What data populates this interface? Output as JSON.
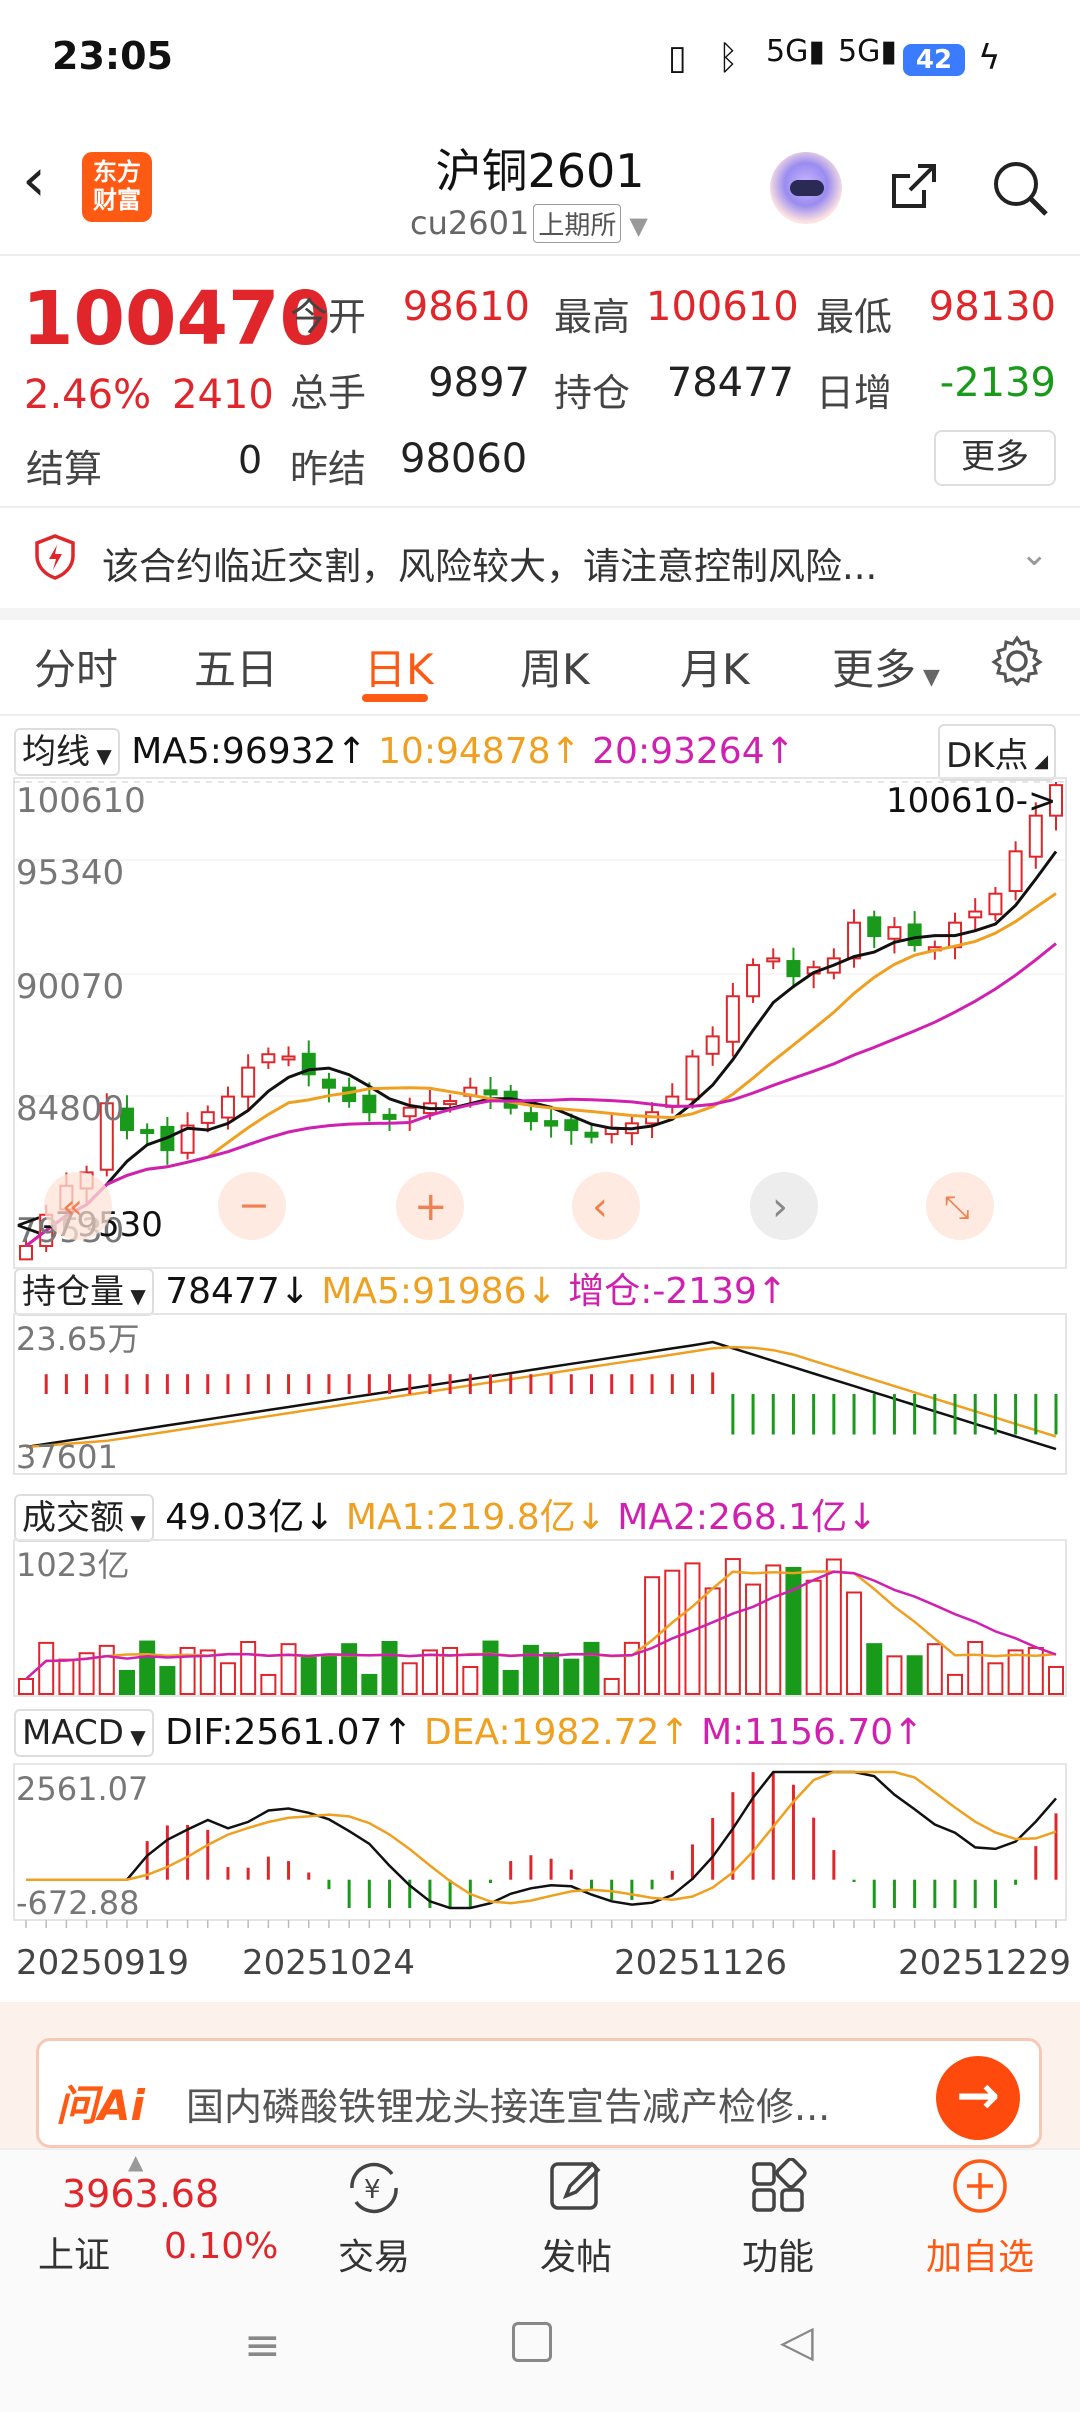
{
  "status": {
    "time": "23:05",
    "battery": "42"
  },
  "header": {
    "title": "沪铜2601",
    "code": "cu2601",
    "exchange": "上期所",
    "logo_line1": "东方",
    "logo_line2": "财富"
  },
  "quote": {
    "price": "100470",
    "pct": "2.46%",
    "change": "2410",
    "settle_label": "结算",
    "settle_value": "0",
    "open_label": "今开",
    "open_value": "98610",
    "high_label": "最高",
    "high_value": "100610",
    "low_label": "最低",
    "low_value": "98130",
    "volume_label": "总手",
    "volume_value": "9897",
    "oi_label": "持仓",
    "oi_value": "78477",
    "daychg_label": "日增",
    "daychg_value": "-2139",
    "prevsettle_label": "昨结",
    "prevsettle_value": "98060",
    "more_label": "更多"
  },
  "risk": {
    "text": "该合约临近交割，风险较大，请注意控制风险..."
  },
  "tabs": [
    "分时",
    "五日",
    "日K",
    "周K",
    "月K",
    "更多"
  ],
  "kline": {
    "ma_chip": "均线",
    "ma5": "MA5:96932↑",
    "ma10": "10:94878↑",
    "ma20": "20:93264↑",
    "dk_label": "DK点",
    "axis": [
      "100610",
      "95340",
      "90070",
      "84800",
      "79530"
    ],
    "high_marker": "100610->",
    "low_marker": "<-79530"
  },
  "oi_panel": {
    "chip": "持仓量",
    "value": "78477↓",
    "ma5": "MA5:91986↓",
    "inc": "增仓:-2139↑",
    "axis_top": "23.65万",
    "axis_bottom": "37601"
  },
  "amount_panel": {
    "chip": "成交额",
    "value": "49.03亿↓",
    "ma1": "MA1:219.8亿↓",
    "ma2": "MA2:268.1亿↓",
    "axis_top": "1023亿"
  },
  "macd_panel": {
    "chip": "MACD",
    "dif": "DIF:2561.07↑",
    "dea": "DEA:1982.72↑",
    "m": "M:1156.70↑",
    "axis_top": "2561.07",
    "axis_bottom": "-672.88"
  },
  "dates": [
    "20250919",
    "20251024",
    "20251126",
    "20251229"
  ],
  "ai": {
    "logo": "问Ai",
    "text": "国内磷酸铁锂龙头接连宣告减产检修..."
  },
  "bottom": {
    "index_value": "3963.68",
    "index_name": "上证",
    "index_pct": "0.10%",
    "trade": "交易",
    "post": "发帖",
    "func": "功能",
    "watch": "加自选"
  },
  "colors": {
    "up": "#e0262a",
    "down": "#1a9a1a",
    "accent": "#ff5a14",
    "ma5": "#111111",
    "ma10": "#f0a020",
    "ma20": "#d020b0"
  },
  "chart_data": {
    "type": "candlestick",
    "close": [
      79800,
      81200,
      82500,
      83100,
      86200,
      85000,
      84900,
      84100,
      85200,
      85800,
      86500,
      87800,
      88400,
      88300,
      87500,
      86900,
      86300,
      85800,
      85500,
      86000,
      86200,
      86300,
      86900,
      86600,
      86000,
      85400,
      85200,
      85000,
      84700,
      85100,
      85300,
      85800,
      86500,
      88300,
      89200,
      91000,
      92400,
      92700,
      91900,
      92300,
      92700,
      94300,
      93700,
      94100,
      93300,
      93200,
      94300,
      94800,
      95600,
      97500,
      99100,
      100470
    ],
    "volume_shares": [],
    "open_interest_range": [
      "37601",
      "23.65万"
    ],
    "amount_max": "1023亿",
    "macd_range": [
      -672.88,
      2561.07
    ]
  }
}
